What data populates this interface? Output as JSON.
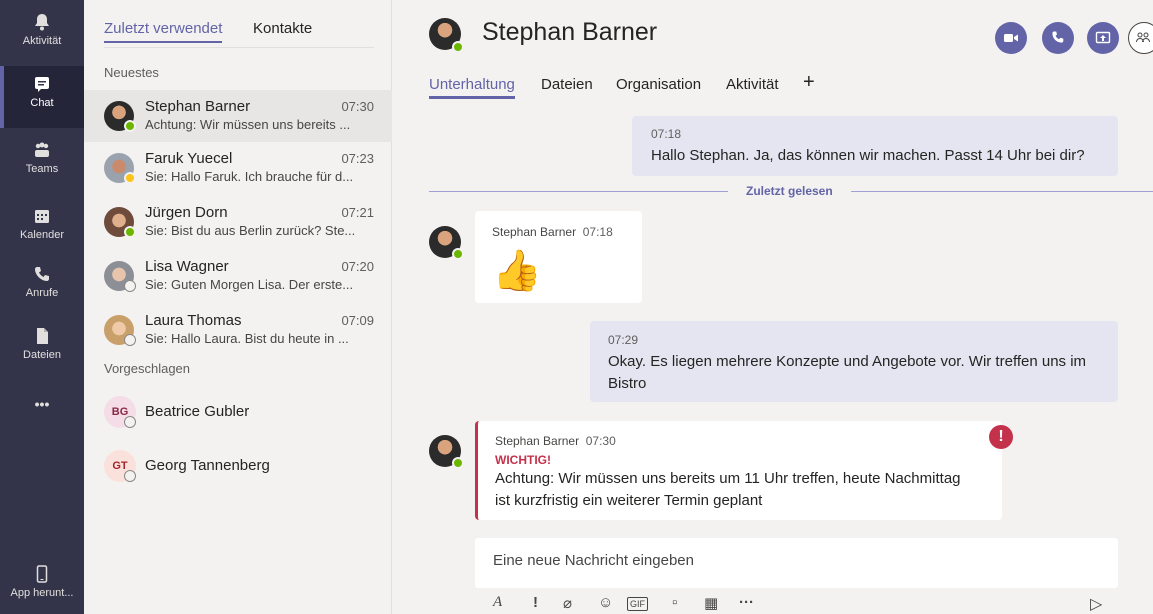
{
  "rail": {
    "items": [
      {
        "label": "Aktivität",
        "icon": "bell-icon"
      },
      {
        "label": "Chat",
        "icon": "chat-icon"
      },
      {
        "label": "Teams",
        "icon": "teams-icon"
      },
      {
        "label": "Kalender",
        "icon": "calendar-icon"
      },
      {
        "label": "Anrufe",
        "icon": "phone-icon"
      },
      {
        "label": "Dateien",
        "icon": "files-icon"
      },
      {
        "label": "•••",
        "icon": "more-icon"
      }
    ],
    "download_label": "App herunt..."
  },
  "list": {
    "tabs": [
      "Zuletzt verwendet",
      "Kontakte"
    ],
    "recent_heading": "Neuestes",
    "suggested_heading": "Vorgeschlagen",
    "chats": [
      {
        "name": "Stephan Barner",
        "time": "07:30",
        "preview": "Achtung: Wir müssen uns bereits ...",
        "status": "online"
      },
      {
        "name": "Faruk Yuecel",
        "time": "07:23",
        "preview": "Sie: Hallo Faruk. Ich brauche für d...",
        "status": "away"
      },
      {
        "name": "Jürgen Dorn",
        "time": "07:21",
        "preview": "Sie: Bist du aus Berlin zurück? Ste...",
        "status": "online"
      },
      {
        "name": "Lisa Wagner",
        "time": "07:20",
        "preview": "Sie: Guten Morgen Lisa. Der erste...",
        "status": "offline"
      },
      {
        "name": "Laura Thomas",
        "time": "07:09",
        "preview": "Sie: Hallo Laura. Bist du heute in ...",
        "status": "offline"
      }
    ],
    "suggested": [
      {
        "initials": "BG",
        "name": "Beatrice Gubler"
      },
      {
        "initials": "GT",
        "name": "Georg Tannenberg"
      }
    ]
  },
  "header": {
    "name": "Stephan Barner",
    "tabs": [
      "Unterhaltung",
      "Dateien",
      "Organisation",
      "Aktivität",
      "+"
    ]
  },
  "messages": {
    "m1": {
      "time": "07:18",
      "text": "Hallo Stephan. Ja, das können wir machen. Passt 14 Uhr bei dir?"
    },
    "last_read": "Zuletzt gelesen",
    "m2": {
      "sender": "Stephan Barner",
      "time": "07:18",
      "emoji": "👍"
    },
    "m3": {
      "time": "07:29",
      "text_line1": "Okay. Es liegen mehrere Konzepte und Angebote vor. Wir treffen uns im",
      "text_line2": "Bistro"
    },
    "m4": {
      "sender": "Stephan Barner",
      "time": "07:30",
      "flag": "WICHTIG!",
      "text_line1": "Achtung: Wir müssen uns bereits um 11 Uhr treffen, heute Nachmittag",
      "text_line2": "ist kurzfristig ein weiterer Termin geplant"
    }
  },
  "compose": {
    "placeholder": "Eine neue Nachricht eingeben"
  },
  "colors": {
    "accent": "#6264a7",
    "rail": "#33344a",
    "important": "#c4314b",
    "online": "#6bb700",
    "away": "#fcc419"
  }
}
